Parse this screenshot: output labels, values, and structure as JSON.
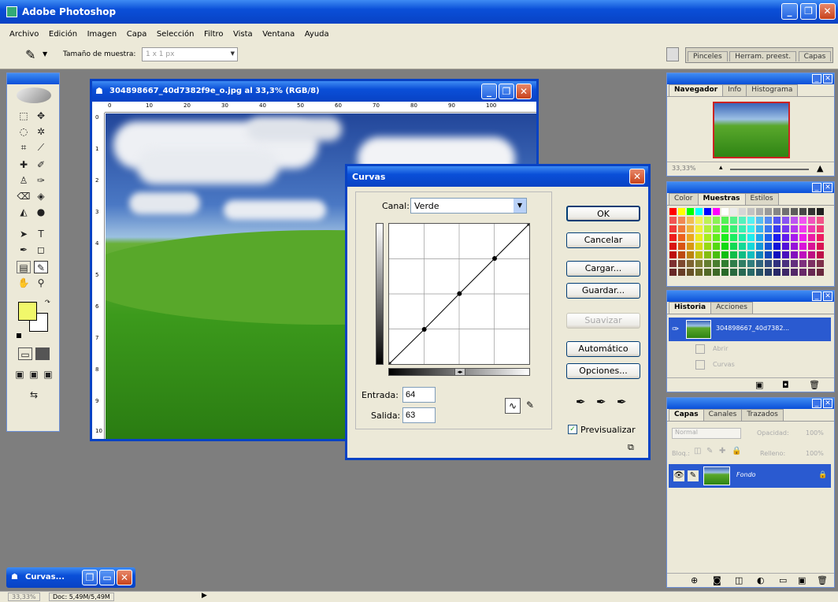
{
  "app": {
    "title": "Adobe Photoshop"
  },
  "menu": [
    "Archivo",
    "Edición",
    "Imagen",
    "Capa",
    "Selección",
    "Filtro",
    "Vista",
    "Ventana",
    "Ayuda"
  ],
  "options_bar": {
    "sample_label": "Tamaño de muestra:",
    "sample_value": "1 x 1 px"
  },
  "palette_well_tabs": [
    "Pinceles",
    "Herram. preest.",
    "Capas"
  ],
  "document": {
    "title": "304898667_40d7382f9e_o.jpg al 33,3% (RGB/8)"
  },
  "ruler_top": [
    "0",
    "10",
    "20",
    "30",
    "40",
    "50",
    "60",
    "70",
    "80",
    "90",
    "100"
  ],
  "ruler_left": [
    "0",
    "1",
    "2",
    "3",
    "4",
    "5",
    "6",
    "7",
    "8",
    "9",
    "10"
  ],
  "curves": {
    "title": "Curvas",
    "channel_label": "Canal:",
    "channel_value": "Verde",
    "buttons": {
      "ok": "OK",
      "cancel": "Cancelar",
      "load": "Cargar...",
      "save": "Guardar...",
      "smooth": "Suavizar",
      "auto": "Automático",
      "options": "Opciones..."
    },
    "input_label": "Entrada:",
    "input_value": "64",
    "output_label": "Salida:",
    "output_value": "63",
    "preview_label": "Previsualizar",
    "points": [
      [
        64,
        63
      ],
      [
        128,
        128
      ],
      [
        192,
        192
      ]
    ]
  },
  "navigator_tabs": [
    "Navegador",
    "Info",
    "Histograma"
  ],
  "navigator_zoom": "33,33%",
  "color_tabs": [
    "Color",
    "Muestras",
    "Estilos"
  ],
  "history_tabs": [
    "Historia",
    "Acciones"
  ],
  "history_items": [
    {
      "label": "304898667_40d7382...",
      "selected": true
    },
    {
      "label": "Abrir",
      "selected": false
    },
    {
      "label": "Curvas",
      "selected": false
    }
  ],
  "layers_tabs": [
    "Capas",
    "Canales",
    "Trazados"
  ],
  "layers_blend": "Normal",
  "layers_opacity_label": "Opacidad:",
  "layers_opacity": "100%",
  "layers_lock_label": "Bloq.:",
  "layers_fill_label": "Relleno:",
  "layers_fill": "100%",
  "layer_name": "Fondo",
  "minimized": {
    "title": "Curvas..."
  },
  "status": {
    "zoom": "33,33%",
    "doc": "Doc: 5,49M/5,49M"
  },
  "colors": {
    "fg": "#f1f86a",
    "bg": "#ffffff"
  }
}
